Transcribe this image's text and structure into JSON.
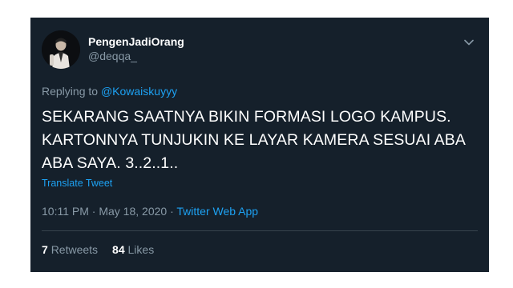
{
  "colors": {
    "background": "#15202b",
    "text": "#ffffff",
    "secondary_text": "#8899a6",
    "link": "#1da1f2",
    "divider": "#38444d"
  },
  "tweet": {
    "author": {
      "display_name": "PengenJadiOrang",
      "handle": "@deqqa_",
      "avatar_icon": "avatar"
    },
    "menu_icon": "chevron-down-icon",
    "reply": {
      "prefix": "Replying to",
      "mention": "@Kowaiskuyyy"
    },
    "text_lines": [
      "SEKARANG SAATNYA BIKIN FORMASI LOGO KAMPUS.",
      "KARTONNYA TUNJUKIN KE LAYAR KAMERA SESUAI ABA",
      "ABA SAYA. 3..2..1.."
    ],
    "translate_label": "Translate Tweet",
    "time": "10:11 PM",
    "separator": "·",
    "date": "May 18, 2020",
    "source": "Twitter Web App",
    "stats": {
      "retweets_count": "7",
      "retweets_label": "Retweets",
      "likes_count": "84",
      "likes_label": "Likes"
    }
  }
}
